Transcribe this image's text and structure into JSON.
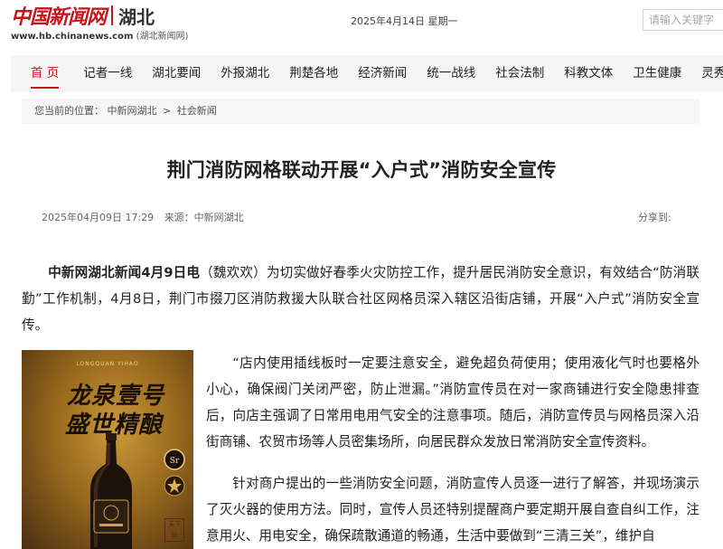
{
  "header": {
    "logo_text": "中国新闻网",
    "region": "湖北",
    "site_url": "www.hb.chinanews.com",
    "site_name": "(湖北新闻网)",
    "date": "2025年4月14日 星期一",
    "search_placeholder": "请输入关键字"
  },
  "nav": {
    "items": [
      {
        "label": "首 页",
        "active": true
      },
      {
        "label": "记者一线"
      },
      {
        "label": "湖北要闻"
      },
      {
        "label": "外报湖北"
      },
      {
        "label": "荆楚各地"
      },
      {
        "label": "经济新闻"
      },
      {
        "label": "统一战线"
      },
      {
        "label": "社会法制"
      },
      {
        "label": "科教文体"
      },
      {
        "label": "卫生健康"
      },
      {
        "label": "灵秀"
      }
    ]
  },
  "breadcrumb": {
    "prefix": "您当前的位置：",
    "home": "中新网湖北",
    "separator": ">",
    "current": "社会新闻"
  },
  "article": {
    "title": "荆门消防网格联动开展“入户式”消防安全宣传",
    "datetime": "2025年04月09日 17:29",
    "source": "来源：中新网湖北",
    "share_label": "分享到:",
    "lead_bold": "中新网湖北新闻4月9日电",
    "p1_rest": "（魏欢欢）为切实做好春季火灾防控工作，提升居民消防安全意识，有效结合“防消联勤”工作机制，4月8日，荆门市掇刀区消防救援大队联合社区网格员深入辖区沿街店铺，开展“入户式”消防安全宣传。",
    "p2": "“店内使用插线板时一定要注意安全，避免超负荷使用；使用液化气时也要格外小心，确保阀门关闭严密，防止泄漏。”消防宣传员在对一家商铺进行安全隐患排查后，向店主强调了日常用电用气安全的注意事项。随后，消防宣传员与网格员深入沿街商铺、农贸市场等人员密集场所，向居民群众发放日常消防安全宣传资料。",
    "p3": "针对商户提出的一些消防安全问题，消防宣传人员逐一进行了解答，并现场演示了灭火器的使用方法。同时，宣传人员还特别提醒商户要定期开展自查自纠工作，注意用火、用电安全，确保疏散通道的畅通，生活中要做到“三清三关”，维护自"
  },
  "ad": {
    "brand": "LONGQUAN YIHAO",
    "line1": "龙泉壹号",
    "line2": "盛世精酿",
    "badge": "Sr",
    "seal": "天下酿"
  },
  "colors": {
    "brand_red": "#c4161c",
    "nav_bg": "#f5f5f5",
    "breadcrumb_bg": "#f6f6f6",
    "text": "#222222"
  }
}
